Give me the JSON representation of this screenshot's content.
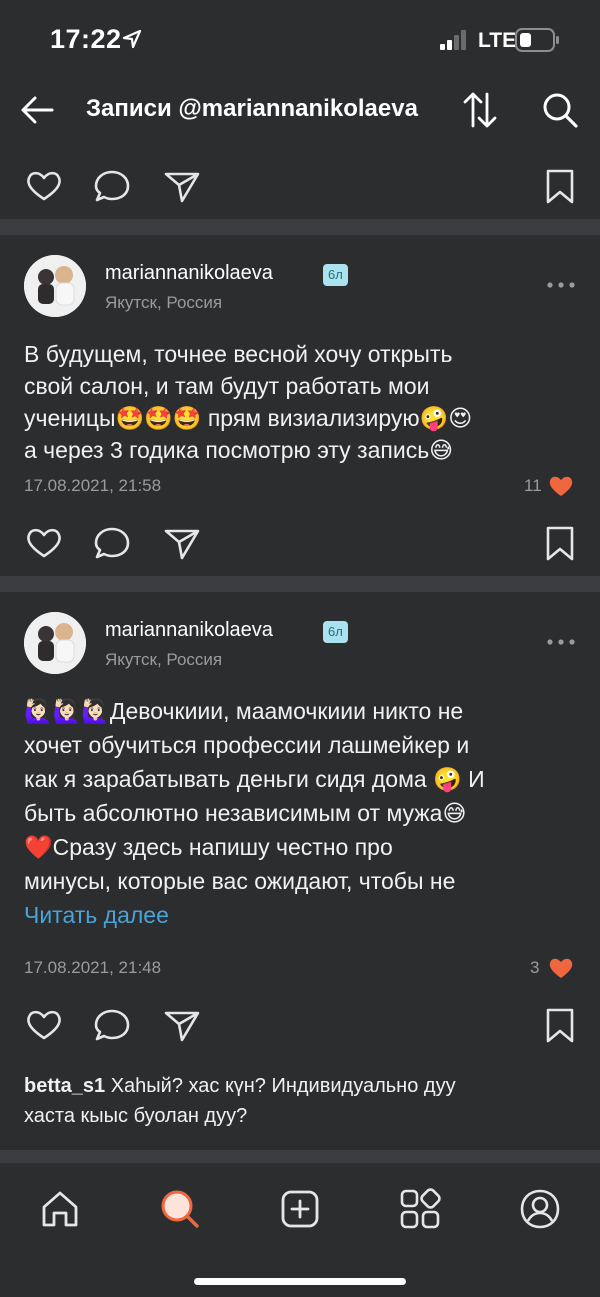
{
  "status_bar": {
    "time": "17:22",
    "network": "LTE"
  },
  "header": {
    "title": "Записи @mariannanikolaeva"
  },
  "posts": [
    {
      "username": "mariannanikolaeva",
      "badge": "6л",
      "location": "Якутск, Россия",
      "text_lines": [
        "В будущем, точнее весной хочу открыть",
        "свой салон, и там будут работать мои",
        "ученицы🤩🤩🤩 прям визиализирую🤪😍",
        "а через 3 годика посмотрю эту запись😅"
      ],
      "date": "17.08.2021, 21:58",
      "likes": "11"
    },
    {
      "username": "mariannanikolaeva",
      "badge": "6л",
      "location": "Якутск, Россия",
      "text_lines": [
        "🙋🏻‍♀️🙋🏻‍♀️🙋🏻‍♀️Девочкиии, маамочкиии никто не",
        "хочет обучиться профессии лашмейкер и",
        "как я зарабатывать деньги сидя дома 🤪 И",
        "быть абсолютно независимым от мужа😅",
        "   ❤️Сразу здесь напишу честно про",
        "минусы, которые вас ожидают, чтобы не"
      ],
      "read_more": "Читать далее",
      "date": "17.08.2021, 21:48",
      "likes": "3",
      "comment": {
        "user": "betta_s1",
        "text_line1": "Хаһый? хас күн? Индивидуально дуу",
        "text_line2": "хаста кыыс буолан дуу?"
      }
    }
  ],
  "colors": {
    "background": "#2c2d2f",
    "divider": "#3b3c3f",
    "accent_link": "#4aa3d6",
    "like_heart": "#f0663f",
    "badge_bg": "#a9e3ef"
  },
  "icons": {
    "like": "heart-outline-icon",
    "comment": "speech-bubble-icon",
    "share": "paper-plane-icon",
    "bookmark": "bookmark-icon",
    "more": "ellipsis-icon",
    "tabs": [
      "home-icon",
      "search-icon",
      "add-post-icon",
      "services-grid-icon",
      "profile-icon"
    ]
  }
}
